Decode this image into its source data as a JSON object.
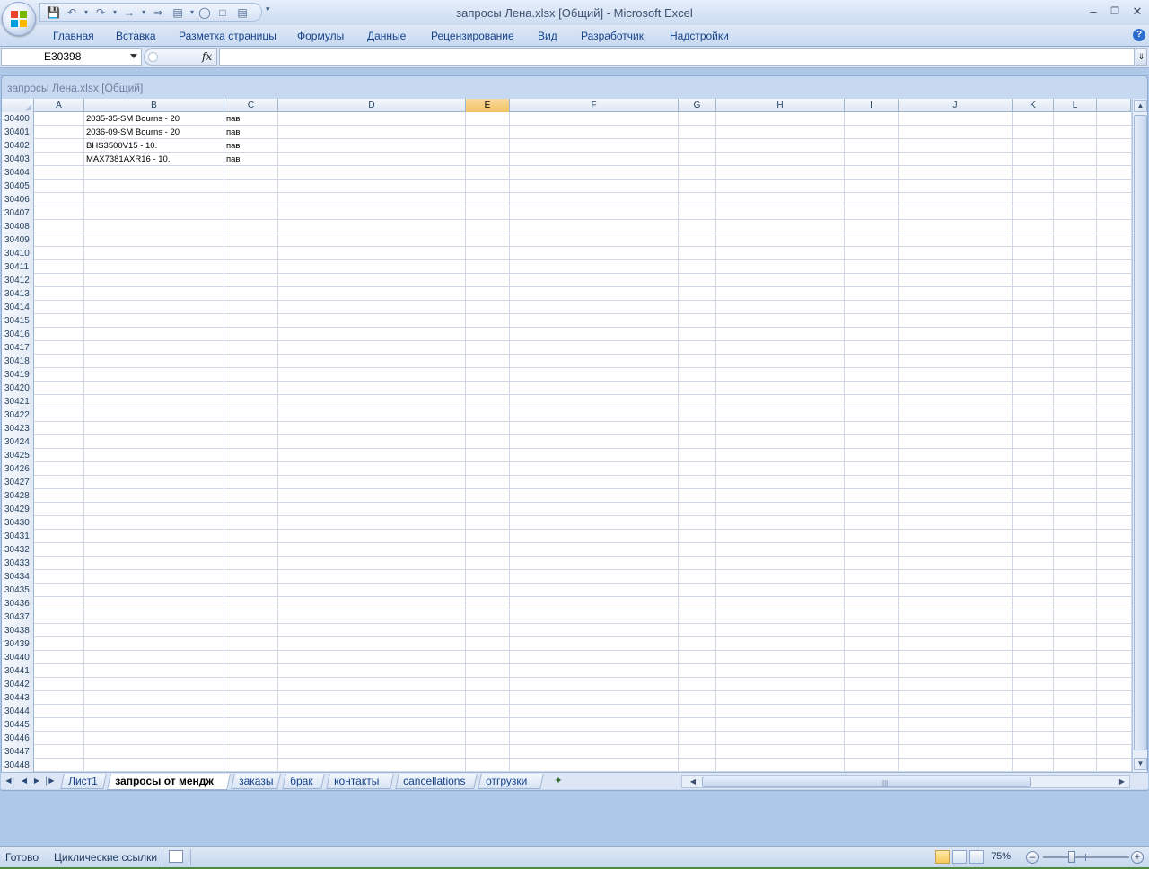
{
  "window": {
    "title": "запросы Лена.xlsx  [Общий] - Microsoft Excel",
    "workbook_title": "запросы Лена.xlsx  [Общий]"
  },
  "ribbon_tabs": [
    "Главная",
    "Вставка",
    "Разметка страницы",
    "Формулы",
    "Данные",
    "Рецензирование",
    "Вид",
    "Разработчик",
    "Надстройки"
  ],
  "formula_bar": {
    "name_box": "E30398",
    "fx_label": "fx",
    "formula": ""
  },
  "columns": [
    "A",
    "B",
    "C",
    "D",
    "E",
    "F",
    "G",
    "H",
    "I",
    "J",
    "K",
    "L"
  ],
  "active_column": "E",
  "rows": [
    {
      "num": "30400",
      "B": "2035-35-SM Bourns - 20",
      "C": "пав"
    },
    {
      "num": "30401",
      "B": "2036-09-SM Bourns - 20",
      "C": "пав"
    },
    {
      "num": "30402",
      "B": "BHS3500V15  -  10.",
      "C": "пав"
    },
    {
      "num": "30403",
      "B": "MAX7381AXR16  -  10.",
      "C": "пав"
    },
    {
      "num": "30404"
    },
    {
      "num": "30405"
    },
    {
      "num": "30406"
    },
    {
      "num": "30407"
    },
    {
      "num": "30408"
    },
    {
      "num": "30409"
    },
    {
      "num": "30410"
    },
    {
      "num": "30411"
    },
    {
      "num": "30412"
    },
    {
      "num": "30413"
    },
    {
      "num": "30414"
    },
    {
      "num": "30415"
    },
    {
      "num": "30416"
    },
    {
      "num": "30417"
    },
    {
      "num": "30418"
    },
    {
      "num": "30419"
    },
    {
      "num": "30420"
    },
    {
      "num": "30421"
    },
    {
      "num": "30422"
    },
    {
      "num": "30423"
    },
    {
      "num": "30424"
    },
    {
      "num": "30425"
    },
    {
      "num": "30426"
    },
    {
      "num": "30427"
    },
    {
      "num": "30428"
    },
    {
      "num": "30429"
    },
    {
      "num": "30430"
    },
    {
      "num": "30431"
    },
    {
      "num": "30432"
    },
    {
      "num": "30433"
    },
    {
      "num": "30434"
    },
    {
      "num": "30435"
    },
    {
      "num": "30436"
    },
    {
      "num": "30437"
    },
    {
      "num": "30438"
    },
    {
      "num": "30439"
    },
    {
      "num": "30440"
    },
    {
      "num": "30441"
    },
    {
      "num": "30442"
    },
    {
      "num": "30443"
    },
    {
      "num": "30444"
    },
    {
      "num": "30445"
    },
    {
      "num": "30446"
    },
    {
      "num": "30447"
    },
    {
      "num": "30448"
    }
  ],
  "sheet_tabs": [
    {
      "label": "Лист1",
      "active": false
    },
    {
      "label": "запросы от мендж",
      "active": true
    },
    {
      "label": "заказы",
      "active": false
    },
    {
      "label": "брак",
      "active": false
    },
    {
      "label": "контакты",
      "active": false
    },
    {
      "label": "cancellations",
      "active": false
    },
    {
      "label": "отгрузки",
      "active": false
    }
  ],
  "status": {
    "ready": "Готово",
    "circular_refs": "Циклические ссылки",
    "zoom": "75%"
  },
  "colors": {
    "accent": "#15428b",
    "active_header": "#f1c15f",
    "gridline": "#d0d7e5"
  }
}
